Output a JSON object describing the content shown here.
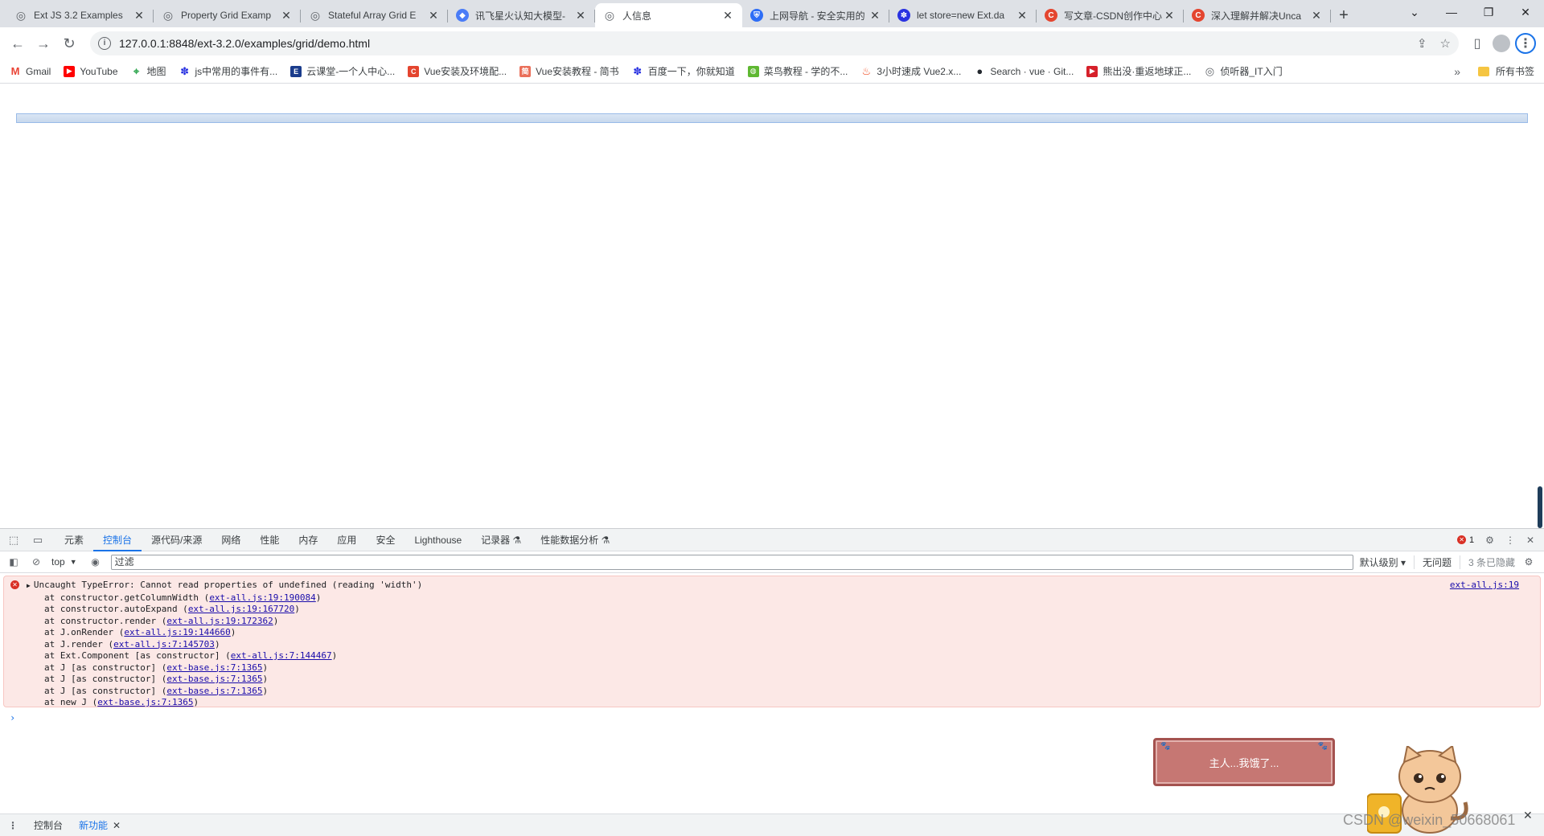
{
  "tabs": [
    {
      "title": "Ext JS 3.2 Examples",
      "icon": "globe-icon",
      "color": "#5f6368"
    },
    {
      "title": "Property Grid Examp",
      "icon": "globe-icon",
      "color": "#5f6368"
    },
    {
      "title": "Stateful Array Grid E",
      "icon": "globe-icon",
      "color": "#5f6368"
    },
    {
      "title": "讯飞星火认知大模型-",
      "icon": "spark-icon",
      "color": "#4a7cf7"
    },
    {
      "title": "人信息",
      "icon": "globe-icon",
      "color": "#5f6368",
      "active": true
    },
    {
      "title": "上网导航 - 安全实用的",
      "icon": "shield-icon",
      "color": "#2d6df6"
    },
    {
      "title": "let store=new Ext.da",
      "icon": "baidu-paw-icon",
      "color": "#2932e1"
    },
    {
      "title": "写文章-CSDN创作中心",
      "icon": "csdn-icon",
      "color": "#e4452f"
    },
    {
      "title": "深入理解并解决Unca",
      "icon": "csdn-icon",
      "color": "#e4452f"
    }
  ],
  "address": {
    "url": "127.0.0.1:8848/ext-3.2.0/examples/grid/demo.html"
  },
  "bookmarks": [
    {
      "label": "Gmail",
      "icon": "gmail-icon",
      "color": "#ea4335"
    },
    {
      "label": "YouTube",
      "icon": "youtube-icon",
      "color": "#ff0000"
    },
    {
      "label": "地图",
      "icon": "maps-icon",
      "color": "#34a853"
    },
    {
      "label": "js中常用的事件有...",
      "icon": "baidu-paw-icon",
      "color": "#2932e1"
    },
    {
      "label": "云课堂-一个人中心...",
      "icon": "etc-icon",
      "color": "#1a3c8c"
    },
    {
      "label": "Vue安装及环境配...",
      "icon": "csdn-icon",
      "color": "#e4452f"
    },
    {
      "label": "Vue安装教程 - 简书",
      "icon": "jianshu-icon",
      "color": "#ea6f5a"
    },
    {
      "label": "百度一下，你就知道",
      "icon": "baidu-paw-icon",
      "color": "#2932e1"
    },
    {
      "label": "菜鸟教程 - 学的不...",
      "icon": "runoob-icon",
      "color": "#5fb832"
    },
    {
      "label": "3小时速成 Vue2.x...",
      "icon": "flame-icon",
      "color": "#f04e23"
    },
    {
      "label": "Search · vue · Git...",
      "icon": "github-icon",
      "color": "#24292f"
    },
    {
      "label": "熊出没·重返地球正...",
      "icon": "video-icon",
      "color": "#d6202a"
    },
    {
      "label": "侦听器_IT入门",
      "icon": "globe-icon",
      "color": "#5f6368"
    }
  ],
  "bookmarks_all": "所有书签",
  "devtools": {
    "tabs": [
      "元素",
      "控制台",
      "源代码/来源",
      "网络",
      "性能",
      "内存",
      "应用",
      "安全",
      "Lighthouse",
      "记录器 ⚗",
      "性能数据分析 ⚗"
    ],
    "active_tab": "控制台",
    "error_count": "1",
    "context": "top",
    "filter_placeholder": "过滤",
    "levels": "默认级别 ▾",
    "issues": "无问题",
    "hidden": "3 条已隐藏",
    "error": {
      "message": "Uncaught TypeError: Cannot read properties of undefined (reading 'width')",
      "source": "ext-all.js:19",
      "frames": [
        {
          "text": "at constructor.getColumnWidth (",
          "link": "ext-all.js:19:190084"
        },
        {
          "text": "at constructor.autoExpand (",
          "link": "ext-all.js:19:167720"
        },
        {
          "text": "at constructor.render (",
          "link": "ext-all.js:19:172362"
        },
        {
          "text": "at J.onRender (",
          "link": "ext-all.js:19:144660"
        },
        {
          "text": "at J.render (",
          "link": "ext-all.js:7:145703"
        },
        {
          "text": "at Ext.Component [as constructor] (",
          "link": "ext-all.js:7:144467"
        },
        {
          "text": "at J [as constructor] (",
          "link": "ext-base.js:7:1365"
        },
        {
          "text": "at J [as constructor] (",
          "link": "ext-base.js:7:1365"
        },
        {
          "text": "at J [as constructor] (",
          "link": "ext-base.js:7:1365"
        },
        {
          "text": "at new J (",
          "link": "ext-base.js:7:1365"
        }
      ]
    },
    "drawer_tabs": [
      "控制台",
      "新功能"
    ],
    "drawer_active": "新功能"
  },
  "pet": {
    "message": "主人...我饿了..."
  },
  "watermark": "CSDN @weixin_50668061"
}
